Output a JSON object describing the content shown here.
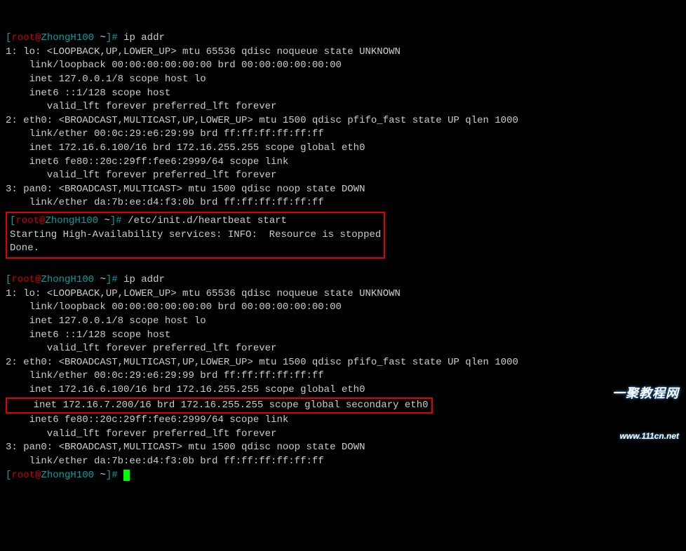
{
  "prompt": {
    "open": "[",
    "close": "]#",
    "user": "root",
    "at": "@",
    "host": "ZhongH100",
    "path": "~"
  },
  "cmds": {
    "ipaddr1": "ip addr",
    "heartbeat": "/etc/init.d/heartbeat start",
    "ipaddr2": "ip addr",
    "last": ""
  },
  "block1": {
    "l1": "1: lo: <LOOPBACK,UP,LOWER_UP> mtu 65536 qdisc noqueue state UNKNOWN",
    "l2": "    link/loopback 00:00:00:00:00:00 brd 00:00:00:00:00:00",
    "l3": "    inet 127.0.0.1/8 scope host lo",
    "l4": "    inet6 ::1/128 scope host",
    "l5": "       valid_lft forever preferred_lft forever",
    "l6": "2: eth0: <BROADCAST,MULTICAST,UP,LOWER_UP> mtu 1500 qdisc pfifo_fast state UP qlen 1000",
    "l7": "    link/ether 00:0c:29:e6:29:99 brd ff:ff:ff:ff:ff:ff",
    "l8": "    inet 172.16.6.100/16 brd 172.16.255.255 scope global eth0",
    "l9": "    inet6 fe80::20c:29ff:fee6:2999/64 scope link",
    "l10": "       valid_lft forever preferred_lft forever",
    "l11": "3: pan0: <BROADCAST,MULTICAST> mtu 1500 qdisc noop state DOWN",
    "l12": "    link/ether da:7b:ee:d4:f3:0b brd ff:ff:ff:ff:ff:ff"
  },
  "hb": {
    "l1": "Starting High-Availability services: INFO:  Resource is stopped",
    "l2": "Done."
  },
  "block2": {
    "l1": "1: lo: <LOOPBACK,UP,LOWER_UP> mtu 65536 qdisc noqueue state UNKNOWN",
    "l2": "    link/loopback 00:00:00:00:00:00 brd 00:00:00:00:00:00",
    "l3": "    inet 127.0.0.1/8 scope host lo",
    "l4": "    inet6 ::1/128 scope host",
    "l5": "       valid_lft forever preferred_lft forever",
    "l6": "2: eth0: <BROADCAST,MULTICAST,UP,LOWER_UP> mtu 1500 qdisc pfifo_fast state UP qlen 1000",
    "l7": "    link/ether 00:0c:29:e6:29:99 brd ff:ff:ff:ff:ff:ff",
    "l8": "    inet 172.16.6.100/16 brd 172.16.255.255 scope global eth0",
    "vip": "    inet 172.16.7.200/16 brd 172.16.255.255 scope global secondary eth0",
    "l9": "    inet6 fe80::20c:29ff:fee6:2999/64 scope link",
    "l10": "       valid_lft forever preferred_lft forever",
    "l11": "3: pan0: <BROADCAST,MULTICAST> mtu 1500 qdisc noop state DOWN",
    "l12": "    link/ether da:7b:ee:d4:f3:0b brd ff:ff:ff:ff:ff:ff"
  },
  "watermark": {
    "top": "一聚教程网",
    "bot": "www.111cn.net"
  }
}
